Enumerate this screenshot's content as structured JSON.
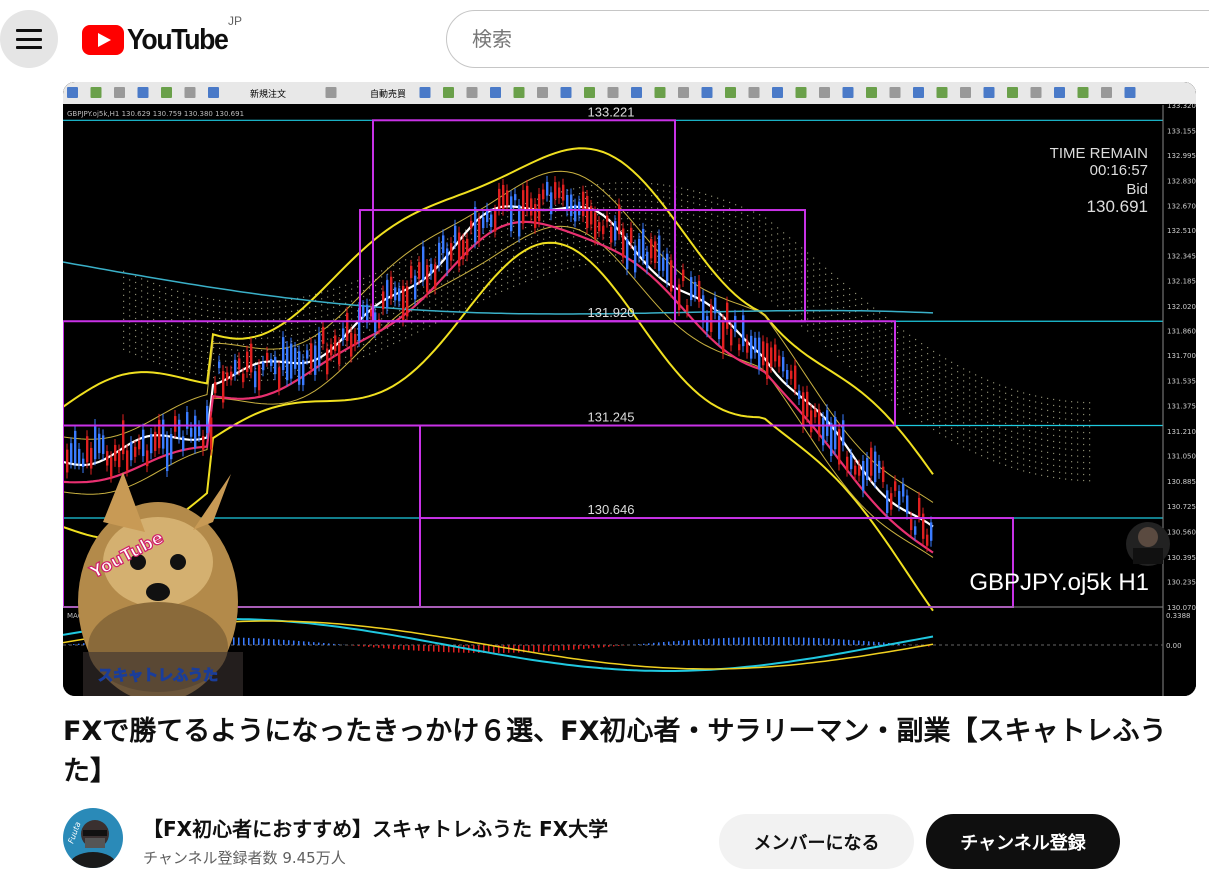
{
  "header": {
    "menu_icon": "hamburger-menu-icon",
    "logo_text": "YouTube",
    "logo_region": "JP",
    "search_placeholder": "検索"
  },
  "video": {
    "platform_toolbar_labels": [
      "新規注文",
      "自動売買"
    ],
    "chart_header": "GBPJPY.oj5k,H1 130.629 130.759 130.380 130.691",
    "time_remain_label": "TIME REMAIN",
    "time_remain_value": "00:16:57",
    "bid_label": "Bid",
    "bid_value": "130.691",
    "symbol_label": "GBPJPY.oj5k H1",
    "levels": [
      "133.221",
      "131.920",
      "131.245",
      "130.646"
    ],
    "price_scale": [
      "133.320",
      "133.155",
      "132.995",
      "132.830",
      "132.670",
      "132.510",
      "132.345",
      "132.185",
      "132.020",
      "131.860",
      "131.700",
      "131.535",
      "131.375",
      "131.210",
      "131.050",
      "130.885",
      "130.725",
      "130.560",
      "130.395",
      "130.235",
      "130.070"
    ],
    "macd_label": "MACD(12,26,9)",
    "macd_scale_top": "0.3388",
    "macd_scale_zero": "0.00",
    "overlay_badge": "YouTube",
    "overlay_caption": "スキャトレふうた"
  },
  "title": "FXで勝てるようになったきっかけ６選、FX初心者・サラリーマン・副業【スキャトレふうた】",
  "channel": {
    "name": "【FX初心者におすすめ】スキャトレふうた FX大学",
    "subscribers": "チャンネル登録者数 9.45万人",
    "avatar_text": "Fuuta"
  },
  "actions": {
    "member_label": "メンバーになる",
    "subscribe_label": "チャンネル登録"
  },
  "colors": {
    "brand_red": "#ff0000",
    "candle_up": "#3a7bff",
    "candle_down": "#e02020",
    "level_line": "#c832e6",
    "level_cyan": "#1ecadf"
  }
}
